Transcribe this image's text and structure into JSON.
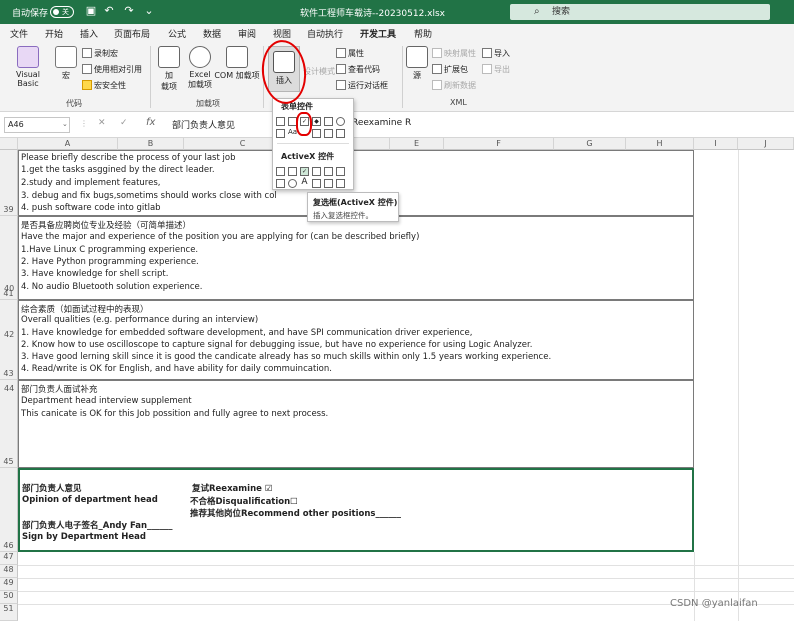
{
  "titlebar": {
    "autosave_label": "自动保存",
    "autosave_state": "关",
    "filename": "软件工程师车载诗--20230512.xlsx",
    "search_placeholder": "搜索"
  },
  "tabs": [
    "文件",
    "开始",
    "插入",
    "页面布局",
    "公式",
    "数据",
    "审阅",
    "视图",
    "自动执行",
    "开发工具",
    "帮助"
  ],
  "active_tab": "开发工具",
  "ribbon": {
    "visual_basic": "Visual Basic",
    "macro": "宏",
    "record_macro": "录制宏",
    "relative_ref": "使用相对引用",
    "macro_security": "宏安全性",
    "group_code": "代码",
    "addins": "加\n载项",
    "excel_addins": "Excel\n加载项",
    "com_addins": "COM 加载项",
    "group_addins": "加载项",
    "insert": "插入",
    "design_mode": "设计模式",
    "properties": "属性",
    "view_code": "查看代码",
    "run_dialog": "运行对话框",
    "source": "源",
    "map_props": "映射属性",
    "expansion_pack": "扩展包",
    "refresh_data": "刷新数据",
    "import": "导入",
    "export": "导出",
    "group_xml": "XML"
  },
  "formula_bar": {
    "name_box": "A46",
    "fx": "fx",
    "content": "部门负责人意见",
    "tail": "Reexamine R"
  },
  "columns": [
    "A",
    "B",
    "C",
    "D",
    "E",
    "F",
    "G",
    "H",
    "I",
    "J"
  ],
  "rows": {
    "r39_lines": [
      "Please briefly describe the process of your last job",
      "1.get the tasks asggined by the direct leader.",
      "2.study and implement features,",
      "3. debug and fix bugs,sometims should works close with col",
      "4. push software code into gitlab"
    ],
    "r41_lines": [
      "是否具备应聘岗位专业及经验（可简单描述）",
      "Have the major and experience of the position you are applying for (can be described briefly)",
      "1.Have Linux C programming experience.",
      "2. Have Python programming experience.",
      "3. Have knowledge for shell script.",
      "4. No audio Bluetooth solution experience."
    ],
    "r43_lines": [
      "综合素质（如面试过程中的表现）",
      "Overall qualities (e.g. performance during an interview)",
      "1. Have knowledge for embedded software development, and have SPI communication driver experience,",
      "2. Know how to use oscilloscope to capture signal for debugging issue, but have no experience for using Logic Analyzer.",
      "3. Have good lerning skill since it is good the candicate already has so much skills within only 1.5 years working experience.",
      "4. Read/write is OK for English, and have ability for daily commuincation."
    ],
    "r45_lines": [
      "部门负责人面试补充",
      "Department head interview supplement",
      "This canicate is OK for this Job possition and fully agree to next process."
    ],
    "r46": {
      "opinion_cn": "部门负责人意见",
      "opinion_en": "Opinion of department head",
      "sign_cn": "部门负责人电子签名_Andy Fan______",
      "sign_en": "Sign by Department Head",
      "reexamine": "复试Reexamine ☑",
      "disqualify": "不合格Disqualification☐",
      "recommend": "推荐其他岗位Recommend other positions______"
    },
    "row_numbers": [
      "39",
      "40",
      "41",
      "42",
      "43",
      "44",
      "45",
      "46",
      "47",
      "48",
      "49",
      "50",
      "51"
    ]
  },
  "dropdown": {
    "form_controls": "表单控件",
    "activex_controls": "ActiveX 控件"
  },
  "tooltip": {
    "title": "复选框(ActiveX 控件)",
    "desc": "插入复选框控件。"
  },
  "watermark": "CSDN @yanlaifan"
}
